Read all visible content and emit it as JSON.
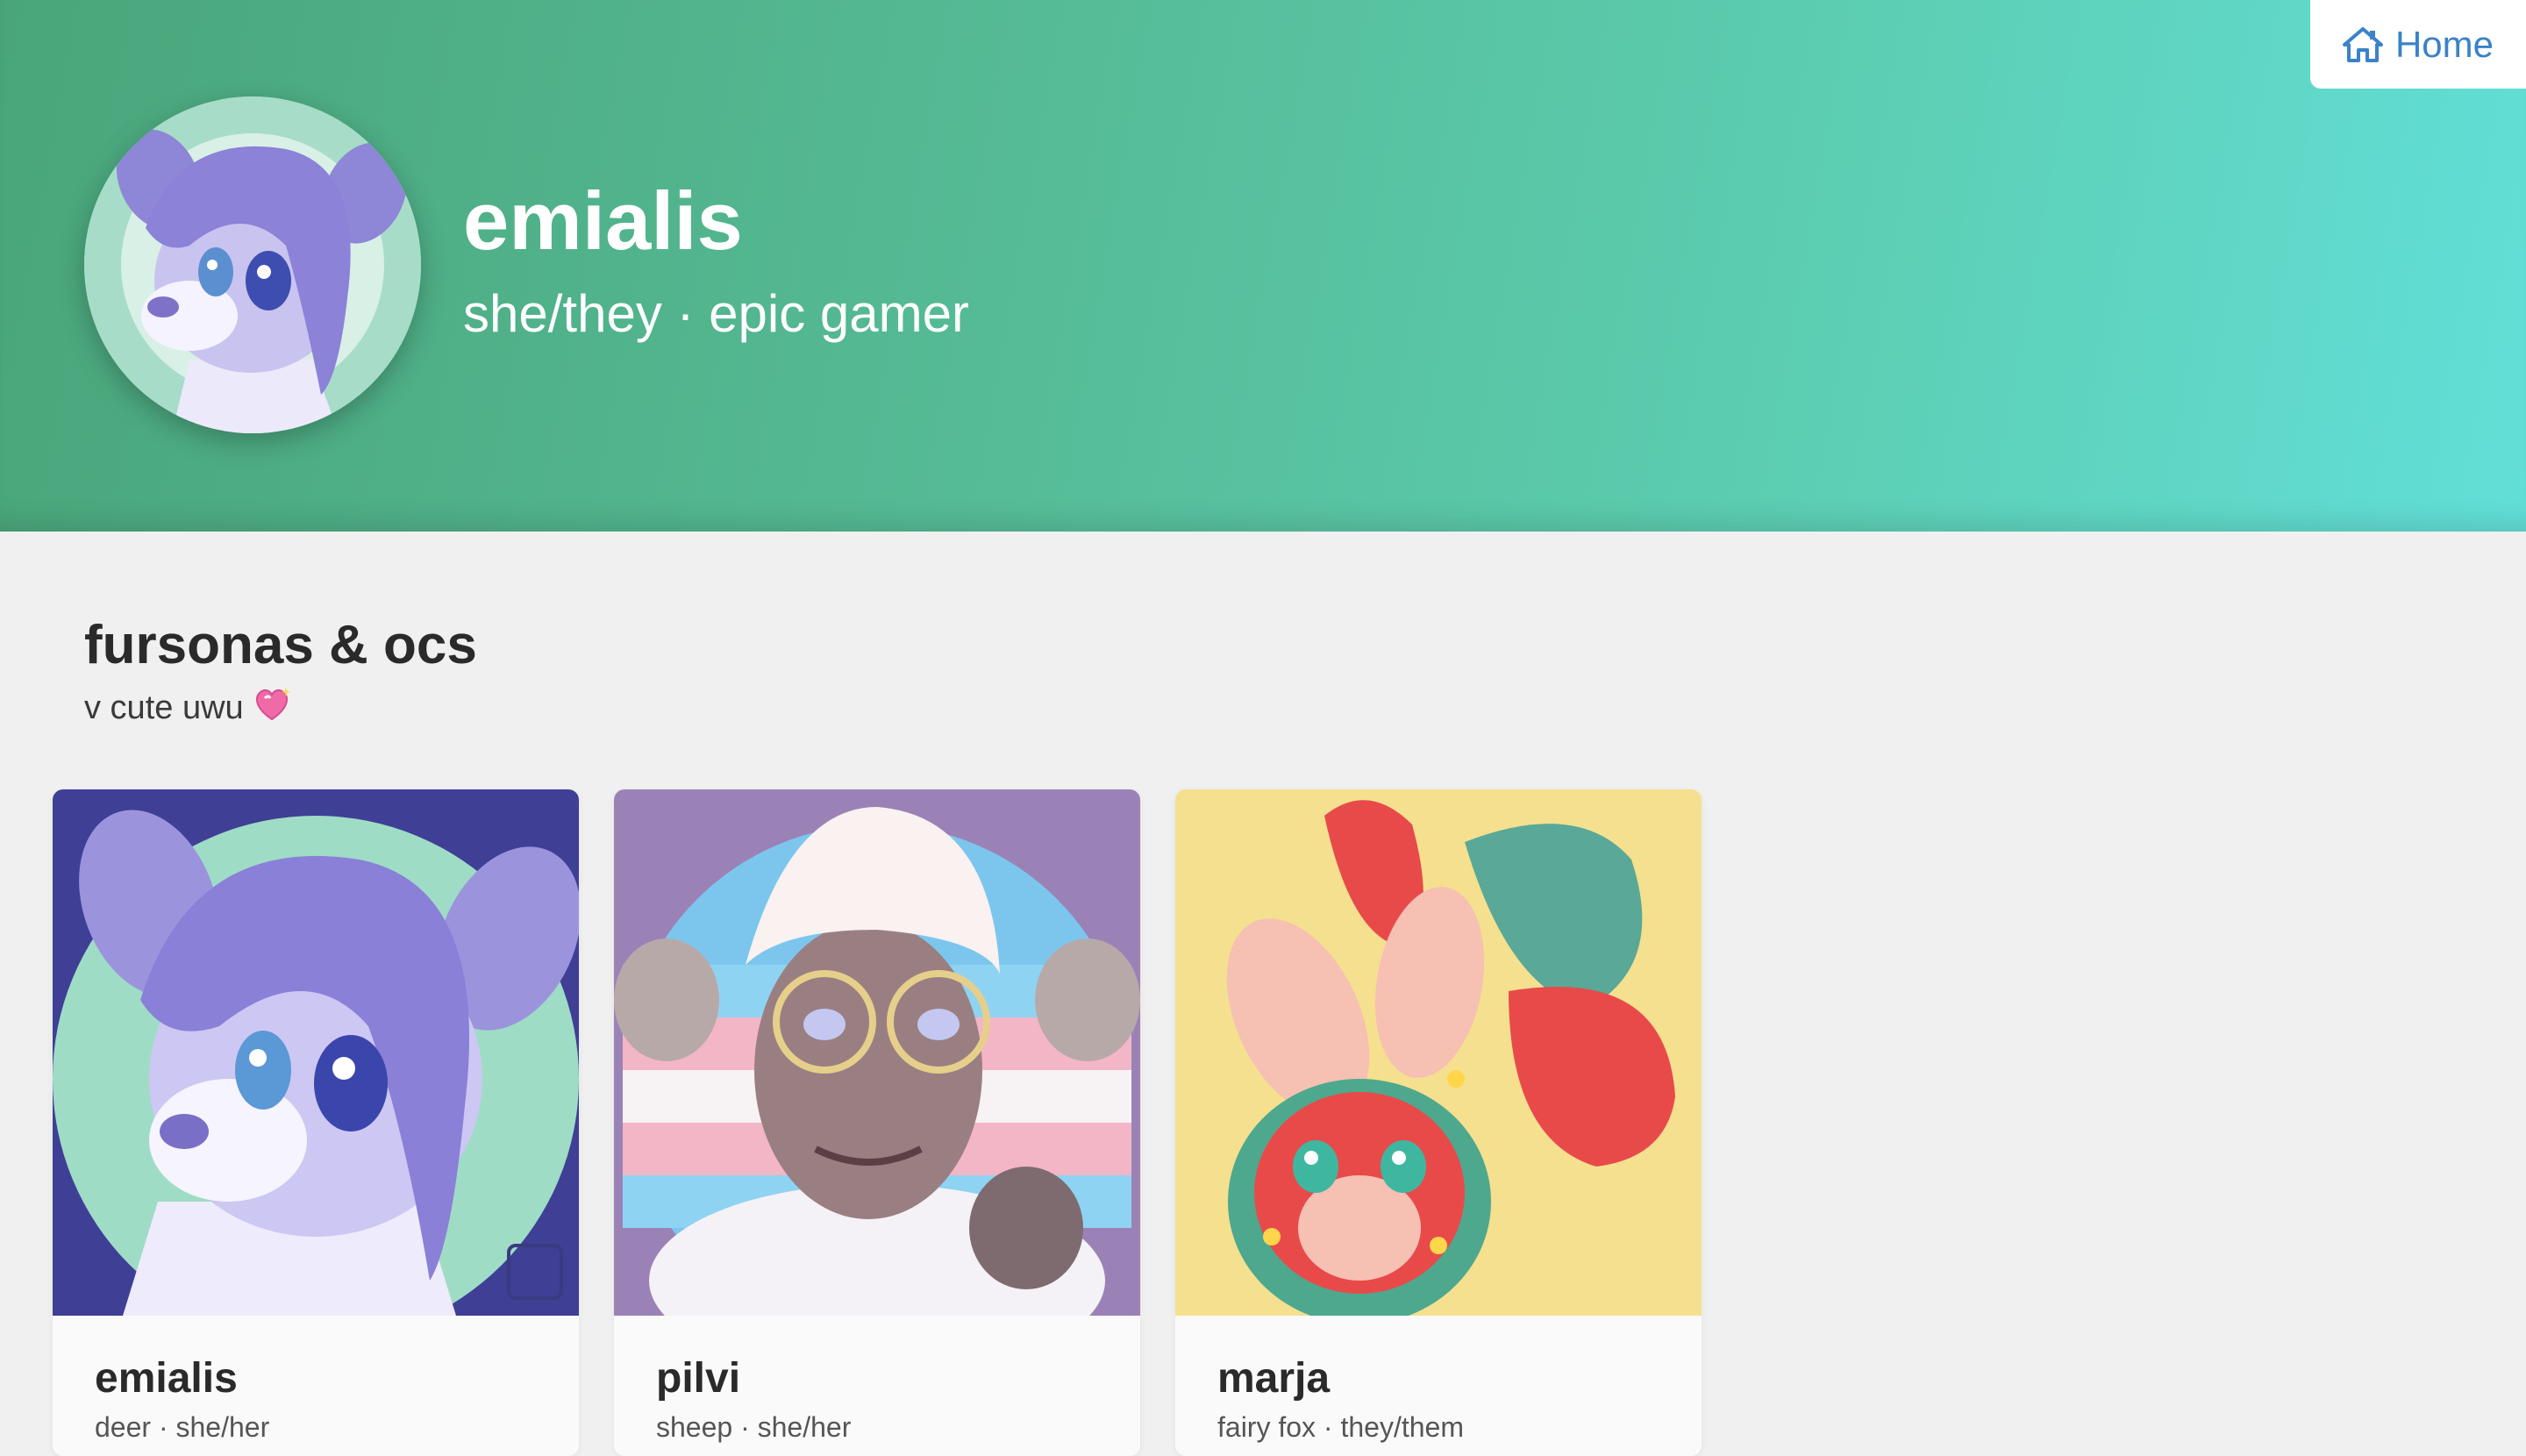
{
  "nav": {
    "home_label": "Home"
  },
  "profile": {
    "name": "emialis",
    "tagline": "she/they · epic gamer",
    "avatar_icon": "deer-character-avatar"
  },
  "section": {
    "title": "fursonas & ocs",
    "subtitle": "v cute uwu",
    "subtitle_emoji": "sparkling-heart-icon"
  },
  "characters": [
    {
      "name": "emialis",
      "description": "deer · she/her",
      "art": "purple-deer-portrait"
    },
    {
      "name": "pilvi",
      "description": "sheep · she/her",
      "art": "sheep-with-glasses-portrait"
    },
    {
      "name": "marja",
      "description": "fairy fox · they/them",
      "art": "strawberry-fox-portrait"
    }
  ],
  "colors": {
    "header_start": "#4aa57a",
    "header_end": "#62dfd8",
    "link": "#3b82c8",
    "background": "#f0f0f0"
  }
}
